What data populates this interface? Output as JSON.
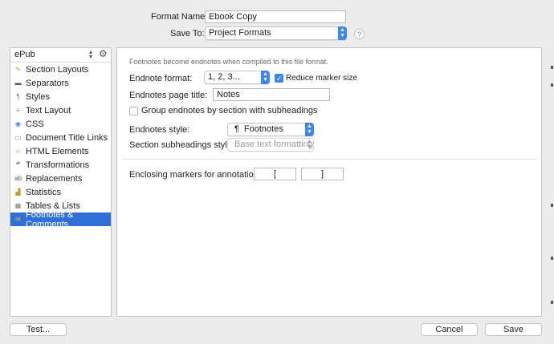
{
  "header": {
    "format_name_label": "Format Name:",
    "format_name_value": "Ebook Copy",
    "save_to_label": "Save To:",
    "save_to_value": "Project Formats",
    "help_glyph": "?"
  },
  "sidebar": {
    "format_type": "ePub",
    "items": [
      {
        "label": "Section Layouts",
        "icon": "brush-icon",
        "glyph": "✎",
        "color": "#c59b2b"
      },
      {
        "label": "Separators",
        "icon": "separator-icon",
        "glyph": "▬",
        "color": "#555555"
      },
      {
        "label": "Styles",
        "icon": "styles-icon",
        "glyph": "¶",
        "color": "#3d86f6"
      },
      {
        "label": "Text Layout",
        "icon": "text-layout-icon",
        "glyph": "≡",
        "color": "#8a8a8a"
      },
      {
        "label": "CSS",
        "icon": "css-icon",
        "glyph": "◉",
        "color": "#3d86f6"
      },
      {
        "label": "Document Title Links",
        "icon": "document-icon",
        "glyph": "▭",
        "color": "#7a7a7a"
      },
      {
        "label": "HTML Elements",
        "icon": "html-icon",
        "glyph": "‹›",
        "color": "#e08a2b"
      },
      {
        "label": "Transformations",
        "icon": "quotes-icon",
        "glyph": "❛❜",
        "color": "#333333"
      },
      {
        "label": "Replacements",
        "icon": "replacements-icon",
        "glyph": "ab",
        "color": "#555555"
      },
      {
        "label": "Statistics",
        "icon": "statistics-icon",
        "glyph": "▟",
        "color": "#c59b2b"
      },
      {
        "label": "Tables & Lists",
        "icon": "table-icon",
        "glyph": "▦",
        "color": "#7a7a7a"
      },
      {
        "label": "Footnotes & Comments",
        "icon": "footnote-comment-icon",
        "glyph": "✉",
        "color": "#e8c22b"
      }
    ],
    "selected_index": 11
  },
  "panel": {
    "description": "Footnotes become endnotes when compiled to this file format.",
    "endnote_format_label": "Endnote format:",
    "endnote_format_value": "1, 2, 3...",
    "reduce_marker_label": "Reduce marker size",
    "reduce_marker_checked": true,
    "page_title_label": "Endnotes page title:",
    "page_title_value": "Notes",
    "group_label": "Group endnotes by section with subheadings",
    "group_checked": false,
    "style_label": "Endnotes style:",
    "style_value": "Footnotes",
    "style_glyph": "¶",
    "subheading_label": "Section subheadings style:",
    "subheading_value": "Base text formatting",
    "enclosing_label": "Enclosing markers for annotations:",
    "enclosing_open": "[",
    "enclosing_close": "]"
  },
  "footer": {
    "test_label": "Test...",
    "cancel_label": "Cancel",
    "save_label": "Save"
  },
  "colors": {
    "accent": "#3d86f6",
    "selection": "#2e6fd8",
    "window_bg": "#ececec"
  }
}
